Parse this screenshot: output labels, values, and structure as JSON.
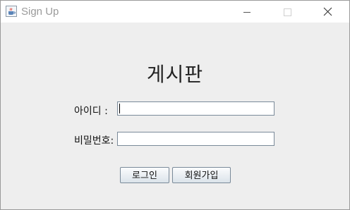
{
  "window": {
    "title": "Sign Up",
    "app_icon": "java-cup-icon",
    "controls": [
      "minimize-icon",
      "maximize-icon",
      "close-icon"
    ]
  },
  "form": {
    "heading": "게시판",
    "id_label": "아이디 :",
    "password_label": "비밀번호:",
    "id_value": "",
    "password_value": ""
  },
  "buttons": {
    "login": "로그인",
    "signup": "회원가입"
  },
  "colors": {
    "title_text": "#9a9a9a",
    "background": "#eeeeee",
    "field_border": "#7a8a99"
  }
}
